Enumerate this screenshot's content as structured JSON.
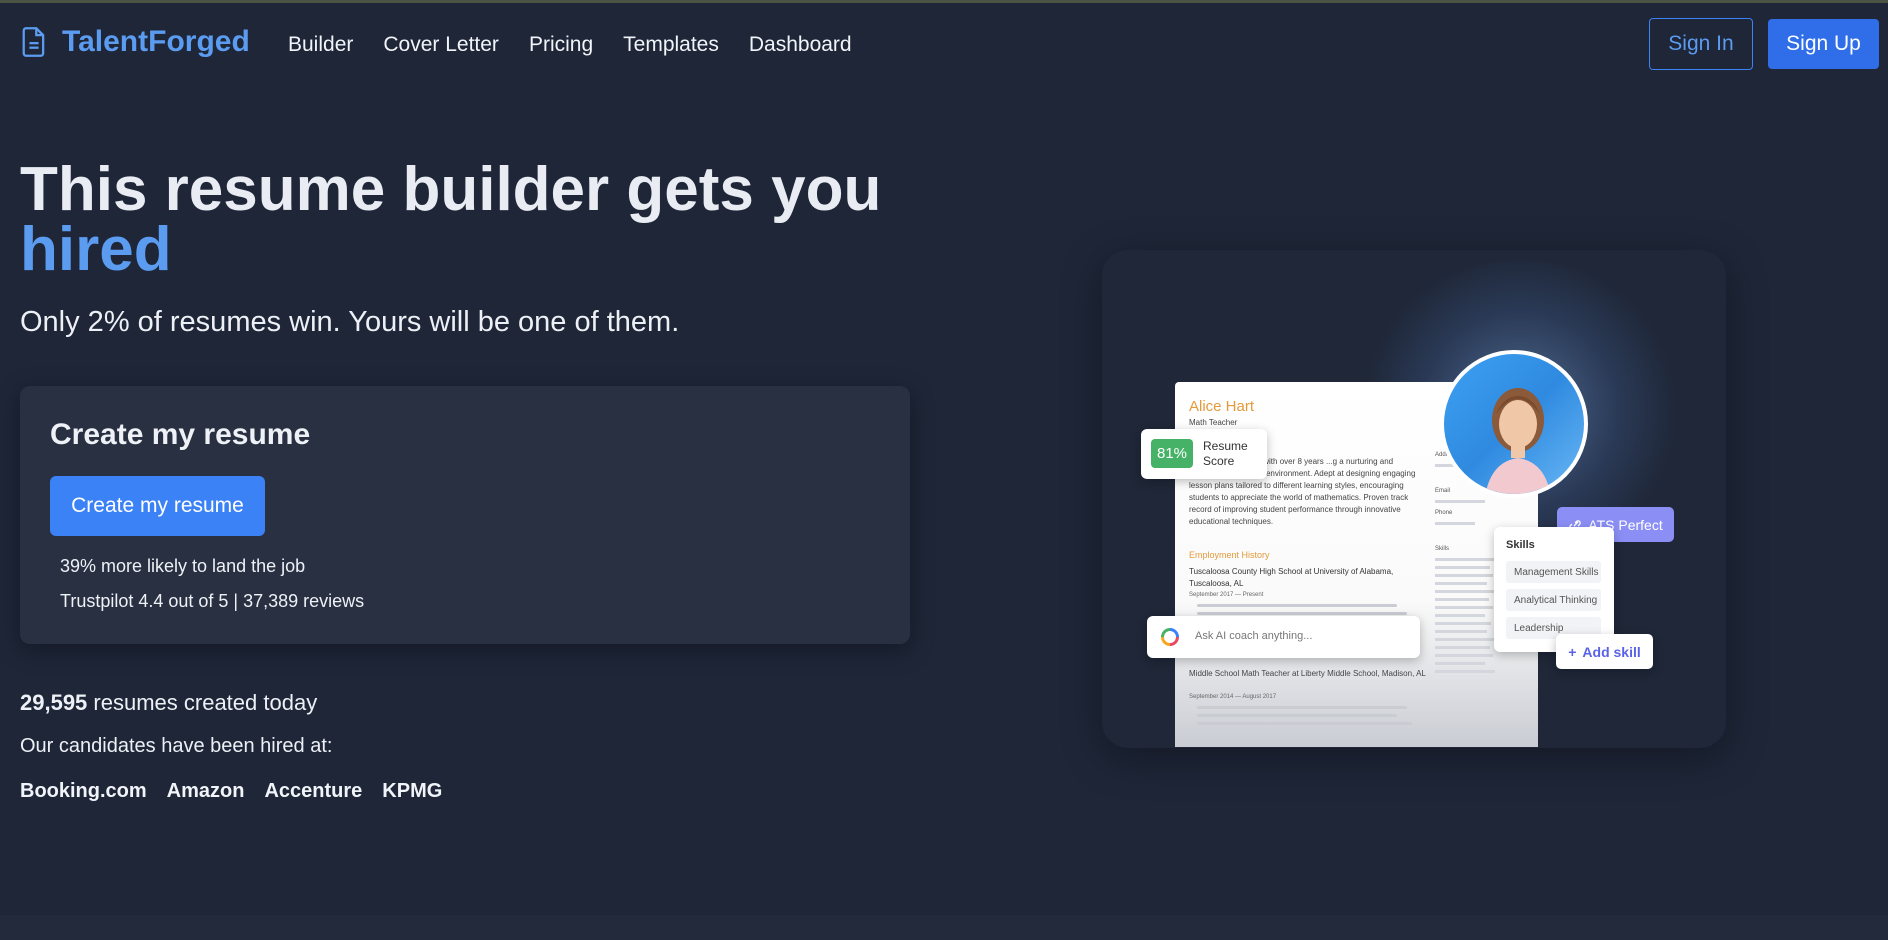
{
  "nav": {
    "brand": "TalentForged",
    "brand_icon": "document-icon",
    "links": [
      "Builder",
      "Cover Letter",
      "Pricing",
      "Templates",
      "Dashboard"
    ],
    "sign_in": "Sign In",
    "sign_up": "Sign Up"
  },
  "hero": {
    "title_main": "This resume builder gets you",
    "title_accent": "hired",
    "subtitle": "Only 2% of resumes win. Yours will be one of them."
  },
  "card": {
    "title": "Create my resume",
    "cta": "Create my resume",
    "stat_likelihood": "39% more likely to land the job",
    "stat_trustpilot": "Trustpilot 4.4 out of 5 | 37,389 reviews"
  },
  "stats": {
    "created_count": "29,595",
    "created_text": " resumes created today",
    "hired_at": "Our candidates have been hired at:",
    "companies": [
      "Booking.com",
      "Amazon",
      "Accenture",
      "KPMG"
    ]
  },
  "illustration": {
    "resume": {
      "name": "Alice Hart",
      "role": "Math Teacher",
      "summary": "...astic math teacher with over 8 years ...g a nurturing and encouraging learning environment. Adept at designing engaging lesson plans tailored to different learning styles, encouraging students to appreciate the world of mathematics. Proven track record of improving student performance through innovative educational techniques.",
      "employment_heading": "Employment History",
      "job1": "Tuscaloosa County High School at University of Alabama, Tuscaloosa, AL",
      "job1_date": "September 2017 — Present",
      "job2": "Middle School Math Teacher at Liberty Middle School, Madison, AL",
      "job2_date": "September 2014 — August 2017",
      "side_labels": [
        "Address",
        "Email",
        "Phone",
        "Skills"
      ]
    },
    "score_value": "81%",
    "score_label": "Resume Score",
    "ats_label": "ATS Perfect",
    "skills_title": "Skills",
    "skills": [
      "Management Skills",
      "Analytical Thinking",
      "Leadership"
    ],
    "add_skill": "Add skill",
    "ai_placeholder": "Ask AI coach anything..."
  },
  "colors": {
    "background": "#1e2638",
    "accent": "#5b9cf0",
    "primary_button": "#3b82f6",
    "card": "#283042",
    "score_green": "#45b267",
    "ats_purple": "#8b8ff5"
  }
}
